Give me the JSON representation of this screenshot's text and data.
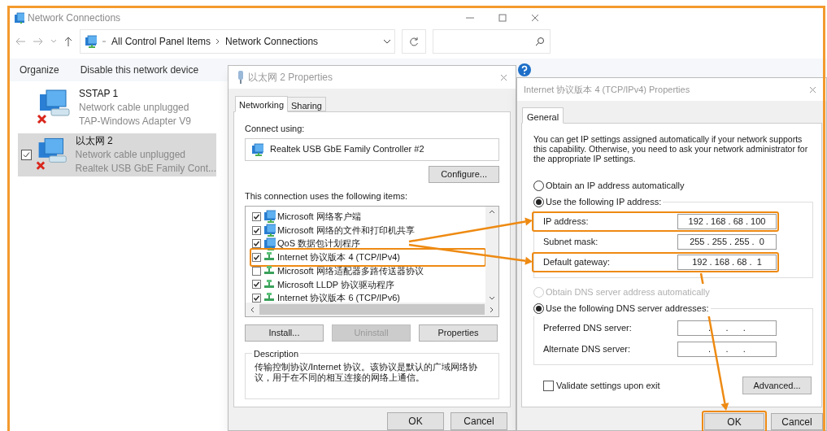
{
  "explorer": {
    "title": "Network Connections",
    "breadcrumb": [
      "All Control Panel Items",
      "Network Connections"
    ],
    "toolbar": [
      "Organize",
      "Disable this network device"
    ],
    "connections": [
      {
        "name": "SSTAP 1",
        "status": "Network cable unplugged",
        "adapter": "TAP-Windows Adapter V9",
        "selected": false
      },
      {
        "name": "以太网 2",
        "status": "Network cable unplugged",
        "adapter": "Realtek USB GbE Family Cont...",
        "selected": true
      }
    ]
  },
  "adapter_dialog": {
    "title": "以太网 2 Properties",
    "tabs": [
      {
        "label": "Networking",
        "selected": true
      },
      {
        "label": "Sharing",
        "selected": false
      }
    ],
    "connect_label": "Connect using:",
    "adapter": "Realtek USB GbE Family Controller #2",
    "configure": "Configure...",
    "items_label": "This connection uses the following items:",
    "items": [
      {
        "label": "Microsoft 网络客户端",
        "checked": true,
        "kind": "client",
        "highlighted": false
      },
      {
        "label": "Microsoft 网络的文件和打印机共享",
        "checked": true,
        "kind": "client",
        "highlighted": false
      },
      {
        "label": "QoS 数据包计划程序",
        "checked": true,
        "kind": "client",
        "highlighted": false
      },
      {
        "label": "Internet 协议版本 4 (TCP/IPv4)",
        "checked": true,
        "kind": "protocol",
        "highlighted": true
      },
      {
        "label": "Microsoft 网络适配器多路传送器协议",
        "checked": false,
        "kind": "protocol",
        "highlighted": false
      },
      {
        "label": "Microsoft LLDP 协议驱动程序",
        "checked": true,
        "kind": "protocol",
        "highlighted": false
      },
      {
        "label": "Internet 协议版本 6 (TCP/IPv6)",
        "checked": true,
        "kind": "protocol",
        "highlighted": false
      }
    ],
    "buttons": [
      {
        "label": "Install...",
        "disabled": false
      },
      {
        "label": "Uninstall",
        "disabled": true
      },
      {
        "label": "Properties",
        "disabled": false
      }
    ],
    "description_label": "Description",
    "description": "传输控制协议/Internet 协议。该协议是默认的广域网络协议，用于在不同的相互连接的网络上通信。",
    "ok": "OK",
    "cancel": "Cancel"
  },
  "ipv4_dialog": {
    "title": "Internet 协议版本 4 (TCP/IPv4) Properties",
    "tabs": [
      {
        "label": "General",
        "selected": true
      }
    ],
    "intro": "You can get IP settings assigned automatically if your network supports this capability. Otherwise, you need to ask your network administrator for the appropriate IP settings.",
    "ip_options": [
      {
        "label": "Obtain an IP address automatically",
        "selected": false,
        "disabled": false
      },
      {
        "label": "Use the following IP address:",
        "selected": true,
        "disabled": false
      }
    ],
    "ip_fields": [
      {
        "label": "IP address:",
        "value": "192 . 168 . 68 . 100",
        "highlighted": true
      },
      {
        "label": "Subnet mask:",
        "value": "255 . 255 . 255 .  0",
        "highlighted": false
      },
      {
        "label": "Default gateway:",
        "value": "192 . 168 . 68 .  1",
        "highlighted": true
      }
    ],
    "dns_options": [
      {
        "label": "Obtain DNS server address automatically",
        "selected": false,
        "disabled": true
      },
      {
        "label": "Use the following DNS server addresses:",
        "selected": true,
        "disabled": false
      }
    ],
    "dns_fields": [
      {
        "label": "Preferred DNS server:",
        "value": ".      .      .",
        "highlighted": false
      },
      {
        "label": "Alternate DNS server:",
        "value": ".      .      .",
        "highlighted": false
      }
    ],
    "validate": {
      "label": "Validate settings upon exit",
      "checked": false
    },
    "advanced": "Advanced...",
    "ok": {
      "label": "OK",
      "highlighted": true
    },
    "cancel": "Cancel"
  }
}
